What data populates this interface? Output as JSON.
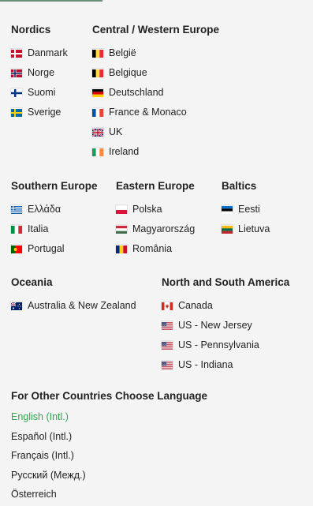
{
  "regions": {
    "nordics": {
      "title": "Nordics",
      "items": [
        {
          "label": "Danmark",
          "flag": "dk"
        },
        {
          "label": "Norge",
          "flag": "no"
        },
        {
          "label": "Suomi",
          "flag": "fi"
        },
        {
          "label": "Sverige",
          "flag": "se"
        }
      ]
    },
    "central": {
      "title": "Central / Western Europe",
      "items": [
        {
          "label": "België",
          "flag": "be"
        },
        {
          "label": "Belgique",
          "flag": "be"
        },
        {
          "label": "Deutschland",
          "flag": "de"
        },
        {
          "label": "France & Monaco",
          "flag": "fr"
        },
        {
          "label": "UK",
          "flag": "gb"
        },
        {
          "label": "Ireland",
          "flag": "ie"
        }
      ]
    },
    "southern": {
      "title": "Southern Europe",
      "items": [
        {
          "label": "Ελλάδα",
          "flag": "gr"
        },
        {
          "label": "Italia",
          "flag": "it"
        },
        {
          "label": "Portugal",
          "flag": "pt"
        }
      ]
    },
    "eastern": {
      "title": "Eastern Europe",
      "items": [
        {
          "label": "Polska",
          "flag": "pl"
        },
        {
          "label": "Magyarország",
          "flag": "hu"
        },
        {
          "label": "România",
          "flag": "ro"
        }
      ]
    },
    "baltics": {
      "title": "Baltics",
      "items": [
        {
          "label": "Eesti",
          "flag": "ee"
        },
        {
          "label": "Lietuva",
          "flag": "lt"
        }
      ]
    },
    "oceania": {
      "title": "Oceania",
      "items": [
        {
          "label": "Australia & New Zealand",
          "flag": "au"
        }
      ]
    },
    "americas": {
      "title": "North and South America",
      "items": [
        {
          "label": "Canada",
          "flag": "ca"
        },
        {
          "label": "US - New Jersey",
          "flag": "us"
        },
        {
          "label": "US - Pennsylvania",
          "flag": "us"
        },
        {
          "label": "US - Indiana",
          "flag": "us"
        }
      ]
    }
  },
  "languages": {
    "title": "For Other Countries Choose Language",
    "items": [
      {
        "label": "English (Intl.)",
        "active": true
      },
      {
        "label": "Español (Intl.)",
        "active": false
      },
      {
        "label": "Français (Intl.)",
        "active": false
      },
      {
        "label": "Русский (Межд.)",
        "active": false
      },
      {
        "label": "Österreich",
        "active": false
      }
    ],
    "active_color": "#2fa84f"
  }
}
